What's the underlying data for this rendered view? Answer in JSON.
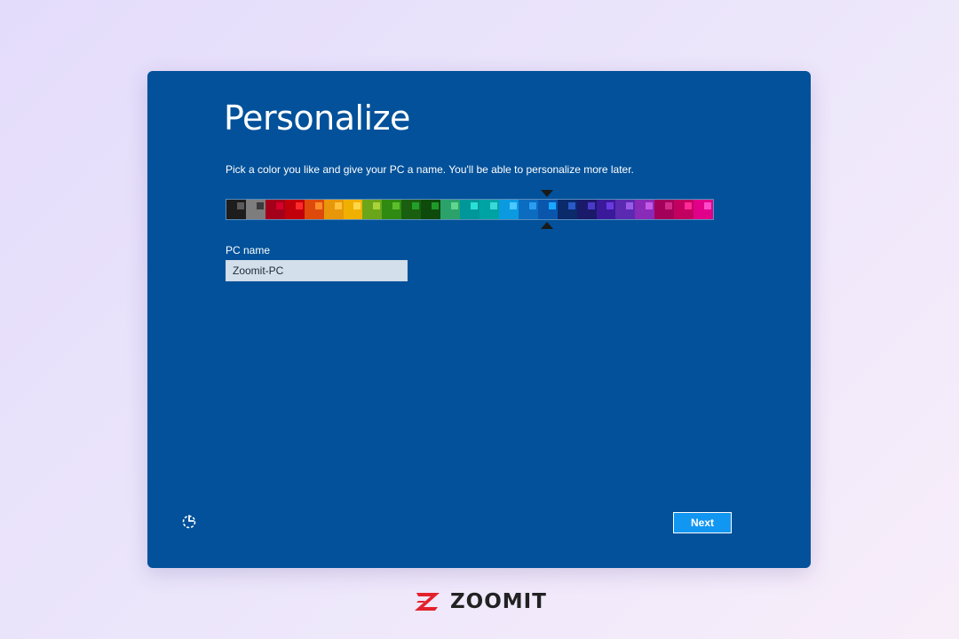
{
  "setup": {
    "title": "Personalize",
    "subtitle": "Pick a color you like and give your PC a name. You'll be able to personalize more later.",
    "pc_name_label": "PC name",
    "pc_name_value": "Zoomit-PC",
    "next_label": "Next",
    "selected_color_index": 16,
    "background_color": "#02519a",
    "colors": [
      {
        "base": "#1d1d1d",
        "accent": "#5a5a5a"
      },
      {
        "base": "#7d7d7d",
        "accent": "#3a3a3a"
      },
      {
        "base": "#a3001a",
        "accent": "#d6002a"
      },
      {
        "base": "#c2000c",
        "accent": "#ff2a2a"
      },
      {
        "base": "#dd4a0c",
        "accent": "#ff8a2a"
      },
      {
        "base": "#e8960a",
        "accent": "#ffc23a"
      },
      {
        "base": "#f0b000",
        "accent": "#ffd84a"
      },
      {
        "base": "#6aa51a",
        "accent": "#a8d43a"
      },
      {
        "base": "#2f8a12",
        "accent": "#5cbf2a"
      },
      {
        "base": "#1a5e10",
        "accent": "#23a02a"
      },
      {
        "base": "#0e4a0c",
        "accent": "#1f9a2a"
      },
      {
        "base": "#2ba26a",
        "accent": "#5fd58e"
      },
      {
        "base": "#00979a",
        "accent": "#2ae0d6"
      },
      {
        "base": "#00a3a3",
        "accent": "#3ad8d8"
      },
      {
        "base": "#0b9ae0",
        "accent": "#4ac8ff"
      },
      {
        "base": "#0b6cc0",
        "accent": "#2a9cf2"
      },
      {
        "base": "#0a56ad",
        "accent": "#1aa8ff"
      },
      {
        "base": "#0a2a6a",
        "accent": "#2a5ac8"
      },
      {
        "base": "#1a1a6a",
        "accent": "#4a3ac8"
      },
      {
        "base": "#3a1a9a",
        "accent": "#6a3ae0"
      },
      {
        "base": "#5a2ab0",
        "accent": "#9a5ae8"
      },
      {
        "base": "#8a2ab8",
        "accent": "#c45ae8"
      },
      {
        "base": "#a3005a",
        "accent": "#d42a8a"
      },
      {
        "base": "#c20060",
        "accent": "#ff2a98"
      },
      {
        "base": "#e0008a",
        "accent": "#ff4acb"
      }
    ]
  },
  "brand": {
    "name": "ZOOMIT",
    "logo_color": "#e3212c"
  }
}
